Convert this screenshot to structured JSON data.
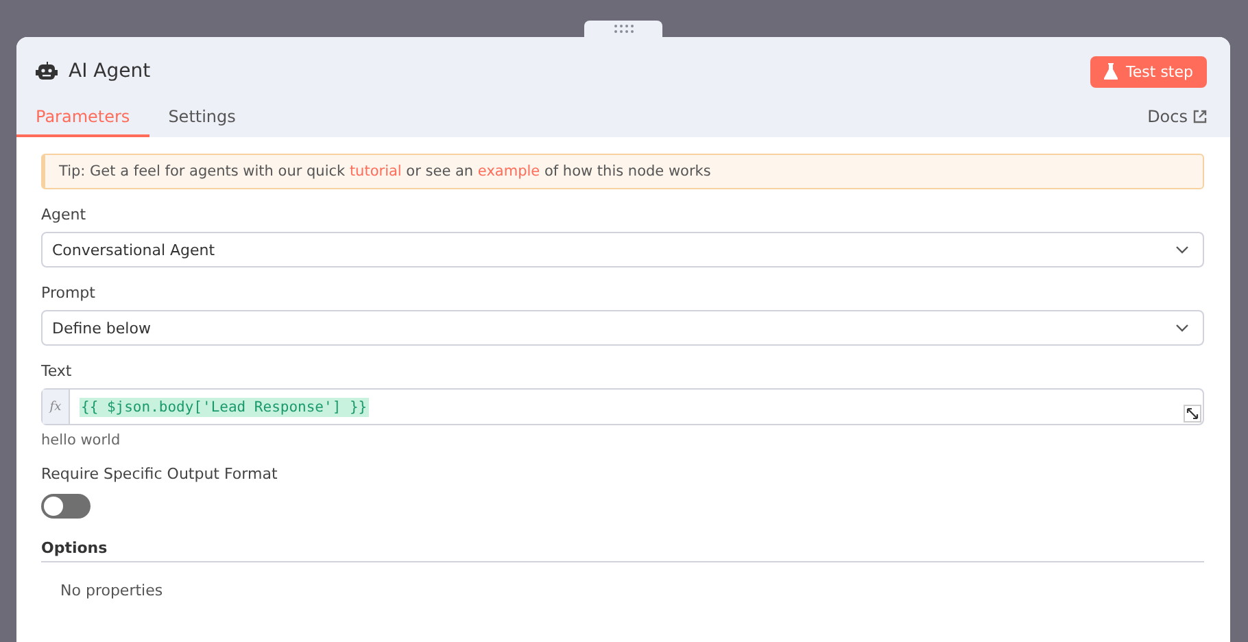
{
  "panel": {
    "title": "AI Agent",
    "test_button": "Test step",
    "docs_link": "Docs"
  },
  "tabs": [
    {
      "label": "Parameters",
      "selected": true
    },
    {
      "label": "Settings",
      "selected": false
    }
  ],
  "tip": [
    {
      "kind": "text",
      "text": "Tip: Get a feel for agents with our quick "
    },
    {
      "kind": "link",
      "text": "tutorial"
    },
    {
      "kind": "text",
      "text": " or see an "
    },
    {
      "kind": "link",
      "text": "example"
    },
    {
      "kind": "text",
      "text": " of how this node works"
    }
  ],
  "fields": [
    {
      "kind": "select",
      "label": "Agent",
      "value": "Conversational Agent"
    },
    {
      "kind": "select",
      "label": "Prompt",
      "value": "Define below"
    },
    {
      "kind": "expression",
      "label": "Text",
      "prefix": "fx",
      "value": "{{ $json.body['Lead Response'] }}",
      "result": "hello world"
    },
    {
      "kind": "toggle",
      "label": "Require Specific Output Format",
      "on": false
    }
  ],
  "options": {
    "title": "Options",
    "empty_text": "No properties"
  }
}
